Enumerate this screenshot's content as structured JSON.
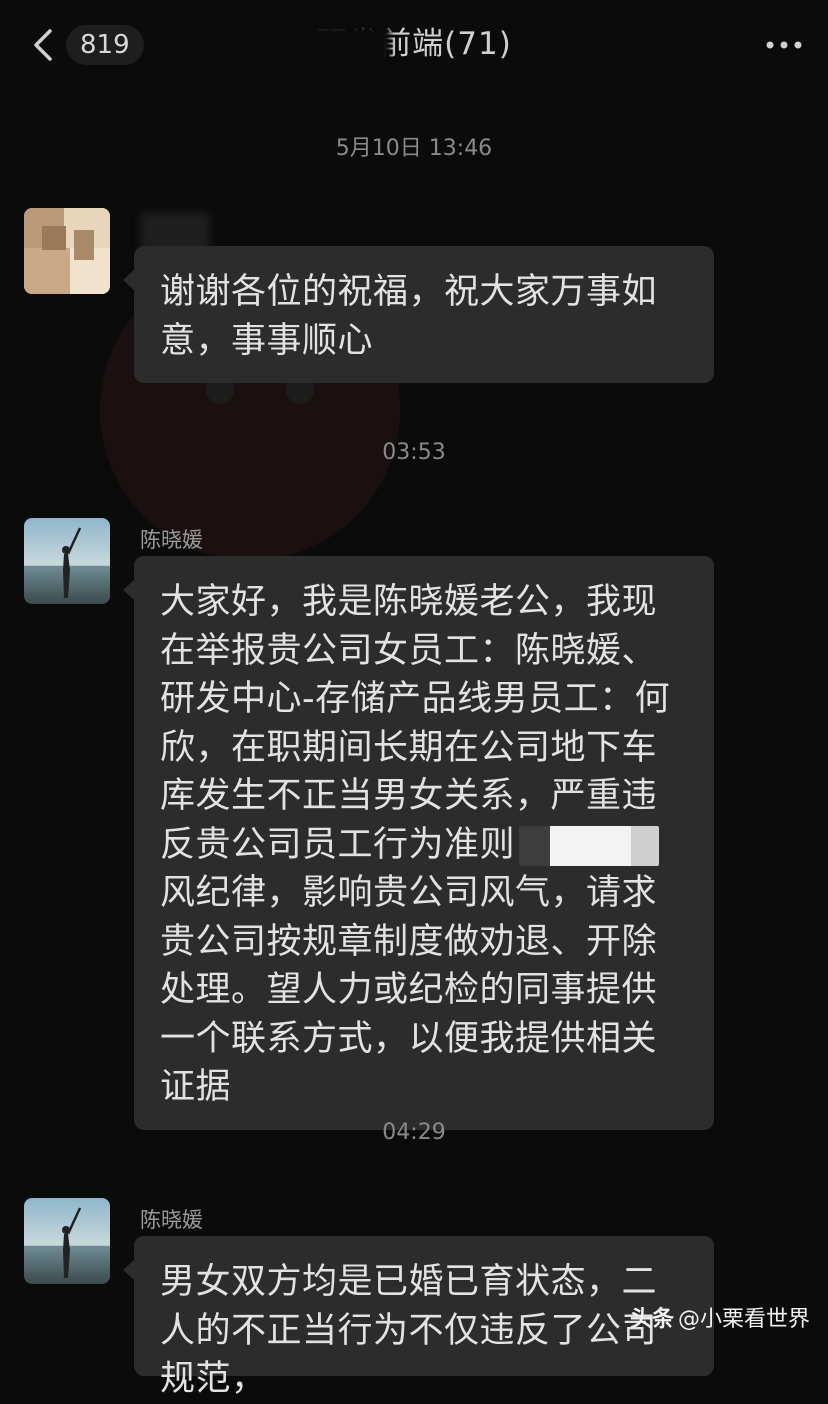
{
  "header": {
    "unread_count": "819",
    "chat_title": "研发前端(71)"
  },
  "messages": [
    {
      "timestamp": "5月10日 13:46",
      "sender": "",
      "text": "谢谢各位的祝福，祝大家万事如意，事事顺心"
    },
    {
      "timestamp": "03:53",
      "sender": "陈晓媛",
      "text_before": "大家好，我是陈晓媛老公，我现在举报贵公司女员工：陈晓媛、研发中心-存储产品线男员工：何欣，在职期间长期在公司地下车库发生不正当男女关系，严重违反贵公司员工行为准则",
      "text_after": "风纪律，影响贵公司风气，请求贵公司按规章制度做劝退、开除处理。望人力或纪检的同事提供一个联系方式，以便我提供相关证据"
    },
    {
      "timestamp": "04:29",
      "sender": "陈晓媛",
      "text": "男女双方均是已婚已育状态，二人的不正当行为不仅违反了公司规范，"
    }
  ],
  "watermark": {
    "logo": "头条",
    "text": "@小栗看世界"
  },
  "icons": {
    "back": "chevron-left-icon",
    "more": "more-dots-icon"
  }
}
